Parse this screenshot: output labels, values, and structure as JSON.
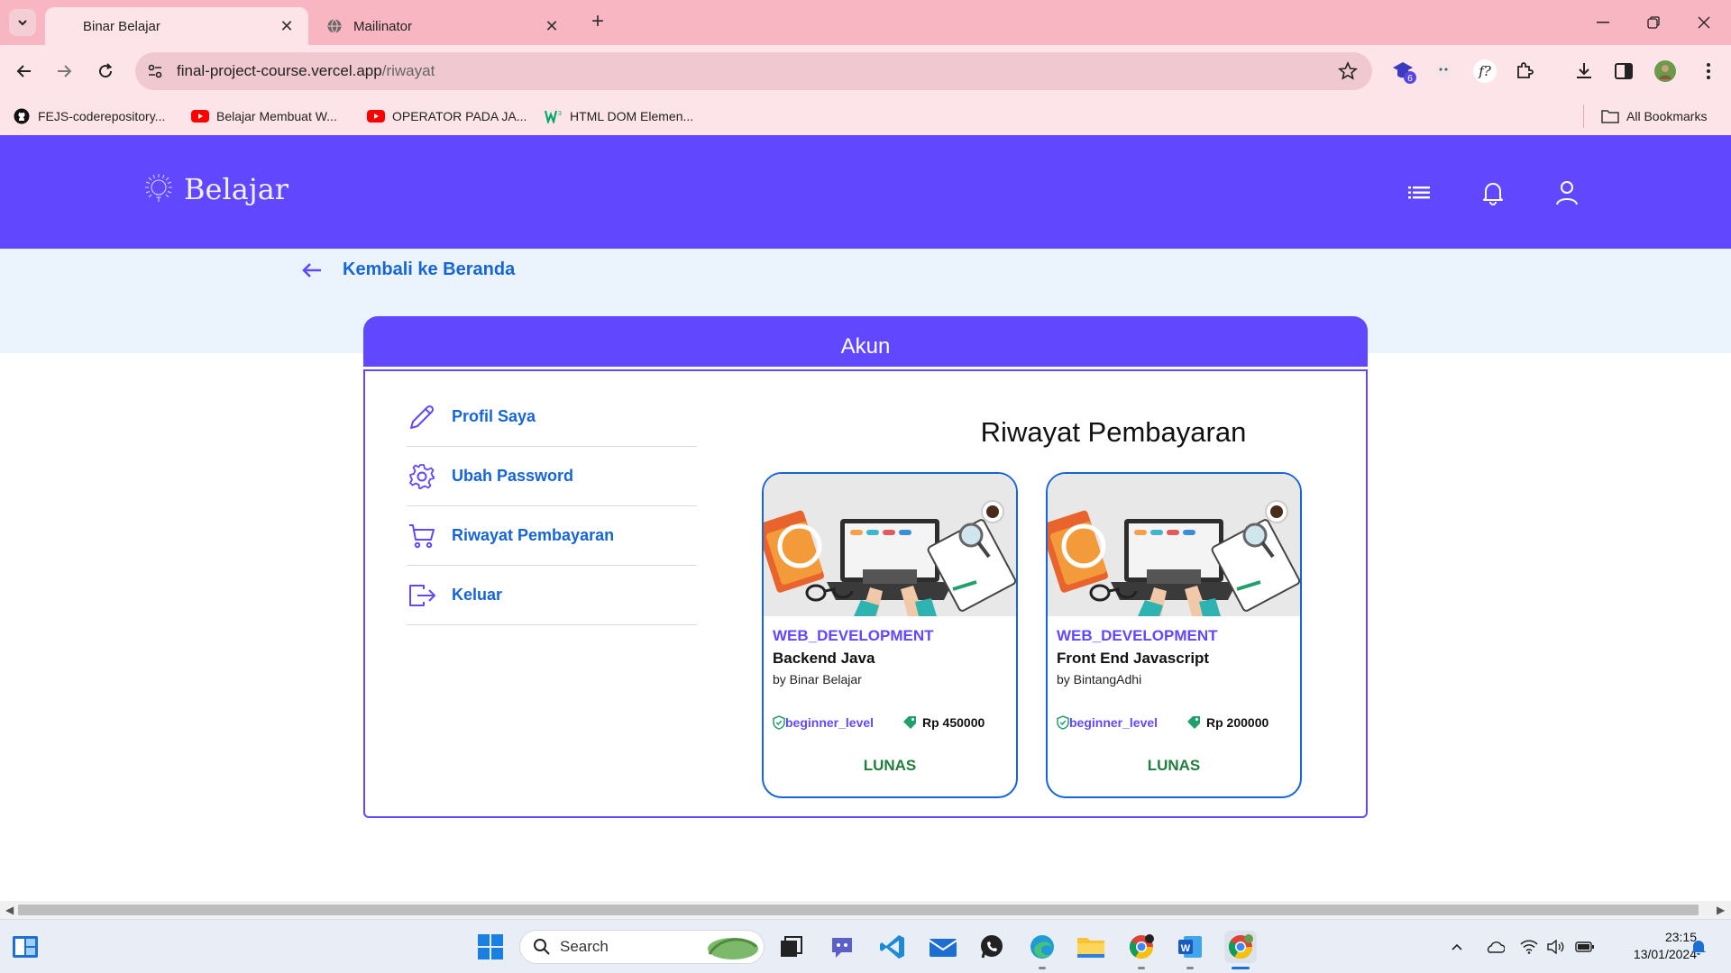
{
  "browser": {
    "tabs": [
      {
        "title": "Binar Belajar",
        "active": true
      },
      {
        "title": "Mailinator",
        "active": false
      }
    ],
    "url_host": "final-project-course.vercel.app",
    "url_path": "/riwayat",
    "bookmarks": [
      {
        "label": "FEJS-coderepository...",
        "icon": "github-icon"
      },
      {
        "label": "Belajar Membuat W...",
        "icon": "youtube-icon"
      },
      {
        "label": "OPERATOR PADA JA...",
        "icon": "youtube-icon"
      },
      {
        "label": "HTML DOM Elemen...",
        "icon": "w3schools-icon"
      }
    ],
    "all_bookmarks_label": "All Bookmarks",
    "extension_badge": "6"
  },
  "site": {
    "brand": "Belajar",
    "back_label": "Kembali ke Beranda",
    "account_title": "Akun",
    "menu": [
      {
        "label": "Profil Saya",
        "icon": "pencil-icon"
      },
      {
        "label": "Ubah Password",
        "icon": "gear-icon"
      },
      {
        "label": "Riwayat Pembayaran",
        "icon": "cart-icon"
      },
      {
        "label": "Keluar",
        "icon": "logout-icon"
      }
    ],
    "section_title": "Riwayat Pembayaran",
    "cards": [
      {
        "category": "WEB_DEVELOPMENT",
        "title": "Backend Java",
        "author": "by Binar Belajar",
        "level": "beginner_level",
        "price": "Rp 450000",
        "status": "LUNAS"
      },
      {
        "category": "WEB_DEVELOPMENT",
        "title": "Front End Javascript",
        "author": "by BintangAdhi",
        "level": "beginner_level",
        "price": "Rp 200000",
        "status": "LUNAS"
      }
    ],
    "colors": {
      "primary": "#6148ff",
      "link": "#1665d8",
      "status": "#1e7e3a",
      "band": "#ebf3fc"
    }
  },
  "taskbar": {
    "search_label": "Search",
    "time": "23:15",
    "date": "13/01/2024"
  }
}
